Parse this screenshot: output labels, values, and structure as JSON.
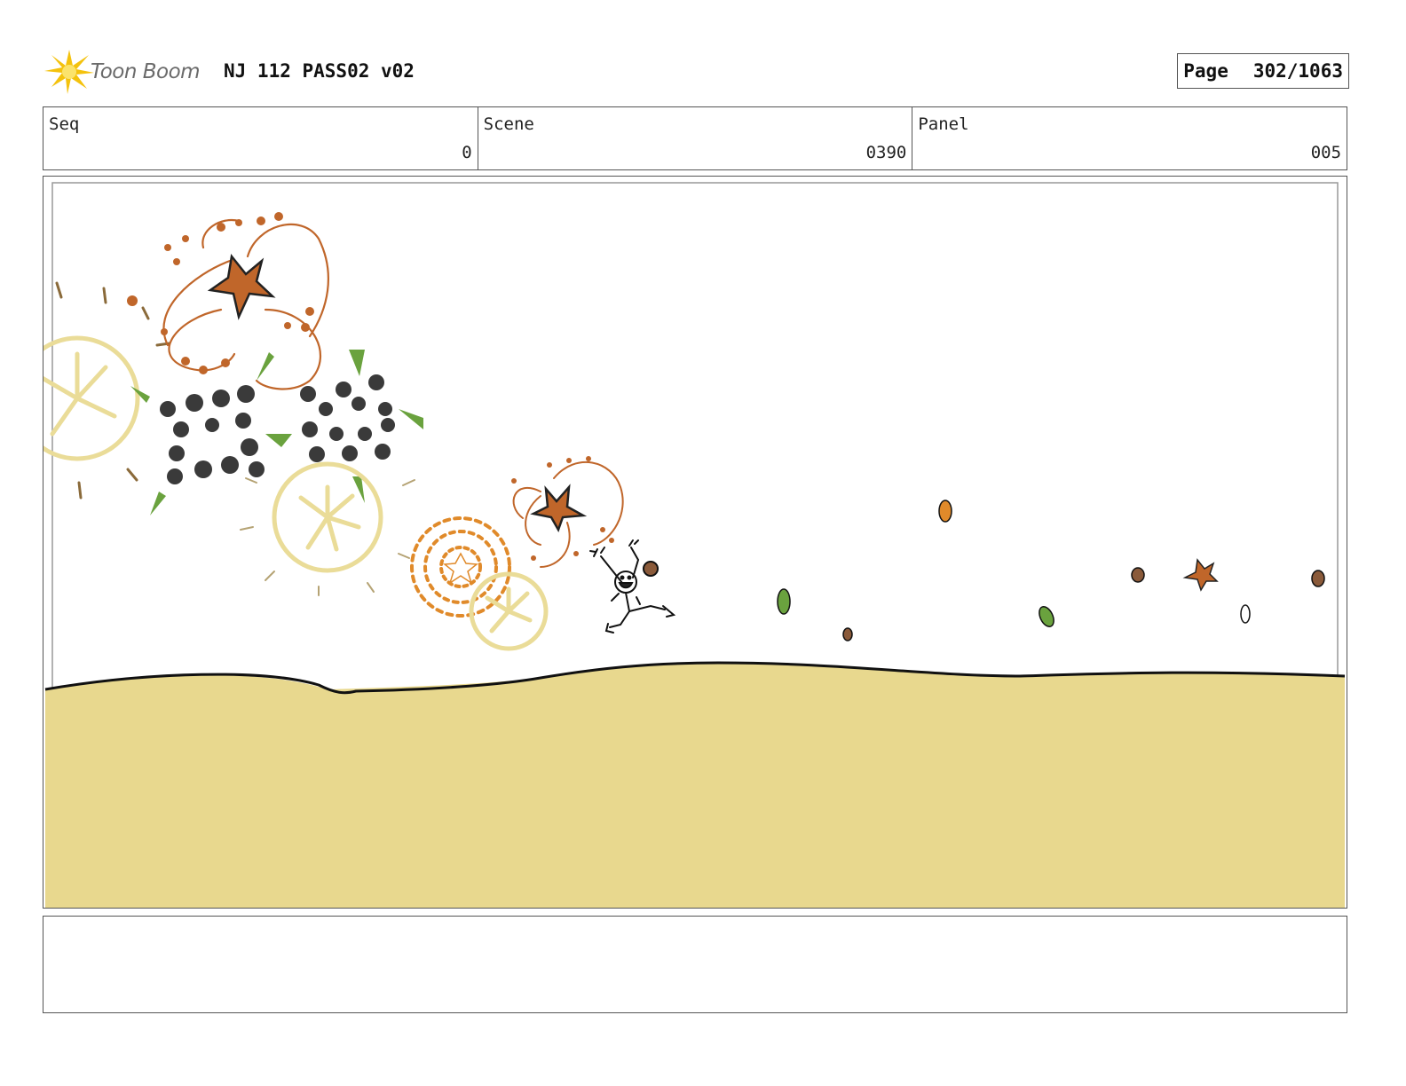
{
  "header": {
    "logo_text": "Toon Boom",
    "doc_title": "NJ 112 PASS02 v02",
    "page_label": "Page",
    "page_value": "302/1063"
  },
  "info": {
    "seq_label": "Seq",
    "seq_value": "0",
    "scene_label": "Scene",
    "scene_value": "0390",
    "panel_label": "Panel",
    "panel_value": "005"
  },
  "panel": {
    "ground_color": "#e8d88e",
    "fireworks": [
      "orange-swirl-star",
      "yellow-starburst",
      "dark-dot-burst",
      "green-spike-burst",
      "orange-bead-burst"
    ],
    "character": "running-child-figure"
  },
  "notes": {
    "text": ""
  }
}
